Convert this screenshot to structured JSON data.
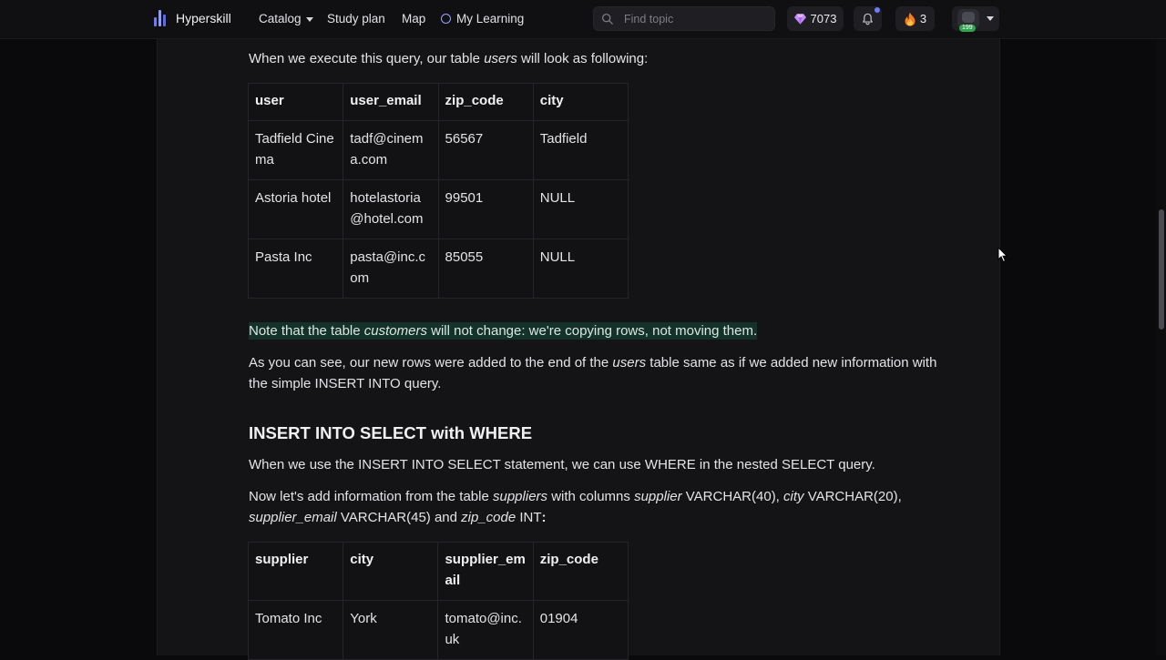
{
  "header": {
    "brand": "Hyperskill",
    "nav": {
      "catalog": "Catalog",
      "study_plan": "Study plan",
      "map": "Map",
      "my_learning": "My Learning"
    },
    "search": {
      "placeholder": "Find topic",
      "value": ""
    },
    "gems": "7073",
    "streak": "3",
    "avatar_badge": "199",
    "icons": [
      "logo-icon",
      "search-icon",
      "gem-icon",
      "bell-icon",
      "fire-icon",
      "avatar-icon"
    ]
  },
  "content": {
    "intro": {
      "before": "When we execute this query, our table ",
      "em": "users",
      "after": " will look as following:"
    },
    "users_table": {
      "headers": [
        "user",
        "user_email",
        "zip_code",
        "city"
      ],
      "rows": [
        [
          "Tadfield Cinema",
          "tadf@cinema.com",
          "56567",
          "Tadfield"
        ],
        [
          "Astoria hotel",
          "hotelastoria@hotel.com",
          "99501",
          "NULL"
        ],
        [
          "Pasta Inc",
          "pasta@inc.com",
          "85055",
          "NULL"
        ]
      ]
    },
    "note": {
      "before": "Note that the table ",
      "em": "customers",
      "after": " will not change: we're copying rows, not moving them."
    },
    "para_added": {
      "before": "As you can see, our new rows were added to the end of the ",
      "em": "users",
      "after": " table same as if we added new information with the simple INSERT INTO query."
    },
    "section_title": "INSERT INTO SELECT with WHERE",
    "para_where": "When we use the INSERT INTO SELECT statement, we can use WHERE in the nested SELECT query.",
    "para_suppliers": {
      "p1": "Now let's add information from the table ",
      "em1": "suppliers",
      "p2": " with columns ",
      "em2": "supplier",
      "p3": " VARCHAR(40), ",
      "em3": "city",
      "p4": " VARCHAR(20), ",
      "em4": "supplier_email",
      "p5": " VARCHAR(45) and ",
      "em5": "zip_code",
      "p6": " INT",
      "p7": ":"
    },
    "suppliers_table": {
      "headers": [
        "supplier",
        "city",
        "supplier_email",
        "zip_code"
      ],
      "rows": [
        [
          "Tomato Inc",
          "York",
          "tomato@inc.uk",
          "01904"
        ]
      ]
    }
  },
  "colors": {
    "accent": "#7c8bff",
    "highlight": "#14322a",
    "background": "#0a0a0c",
    "panel": "#141416"
  }
}
